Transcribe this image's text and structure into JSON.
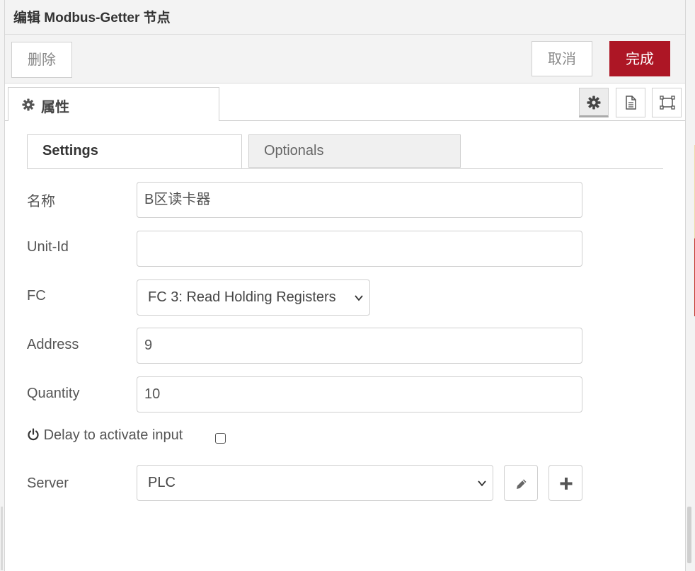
{
  "header": {
    "title": "编辑 Modbus-Getter 节点"
  },
  "toolbar": {
    "delete_label": "删除",
    "cancel_label": "取消",
    "done_label": "完成"
  },
  "tabs": {
    "properties_label": "属性",
    "icons": [
      "gear-icon",
      "description-icon",
      "appearance-icon"
    ]
  },
  "subtabs": [
    {
      "label": "Settings",
      "active": true
    },
    {
      "label": "Optionals",
      "active": false
    }
  ],
  "form": {
    "name": {
      "label": "名称",
      "value": "B区读卡器"
    },
    "unit_id": {
      "label": "Unit-Id",
      "value": ""
    },
    "fc": {
      "label": "FC",
      "value": "FC 3: Read Holding Registers"
    },
    "address": {
      "label": "Address",
      "value": "9"
    },
    "quantity": {
      "label": "Quantity",
      "value": "10"
    },
    "delay": {
      "label": "Delay to activate input",
      "checked": false,
      "icon": "power-icon"
    },
    "server": {
      "label": "Server",
      "value": "PLC"
    }
  },
  "colors": {
    "primary": "#ad1625",
    "border": "#cfcfcf",
    "panel": "#f3f3f3"
  }
}
